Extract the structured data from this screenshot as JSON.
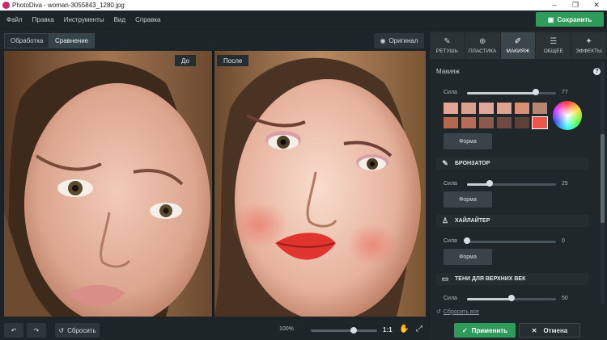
{
  "window": {
    "title": "PhotoDiva - woman-3055843_1280.jpg",
    "controls": [
      "–",
      "❐",
      "✕"
    ]
  },
  "menu": [
    "Файл",
    "Правка",
    "Инструменты",
    "Вид",
    "Справка"
  ],
  "save_label": "Сохранить",
  "modes": [
    "Обработка",
    "Сравнение"
  ],
  "original_label": "Оригинал",
  "tags": {
    "before": "До",
    "after": "После"
  },
  "bottom": {
    "reset_label": "Сбросить",
    "zoom": "100%",
    "zoom_level": 0.65,
    "ratio": "1:1"
  },
  "tabs": [
    {
      "label": "РЕТУШЬ",
      "icon": "retouch-icon",
      "glyph": "✎"
    },
    {
      "label": "ПЛАСТИКА",
      "icon": "plastic-icon",
      "glyph": "⊕"
    },
    {
      "label": "МАКИЯЖ",
      "icon": "makeup-icon",
      "glyph": "✐"
    },
    {
      "label": "ОБЩЕЕ",
      "icon": "sliders-icon",
      "glyph": "☰"
    },
    {
      "label": "ЭФФЕКТЫ",
      "icon": "effects-icon",
      "glyph": "✦"
    }
  ],
  "panel": {
    "heading": "Макияж",
    "help": "?",
    "blush": {
      "strength_label": "Сила",
      "strength_value": "77",
      "strength_level": 0.77,
      "swatches": [
        "#e3a693",
        "#dba18f",
        "#e1a89a",
        "#e0a590",
        "#d88f73",
        "#b88571",
        "#b2684e",
        "#b56d57",
        "#8c5a4d",
        "#6e4a42",
        "#5d4036",
        "#e8574a"
      ],
      "form_label": "Форма"
    },
    "bronzer": {
      "title": "БРОНЗАТОР",
      "strength_label": "Сила",
      "strength_value": "25",
      "strength_level": 0.25,
      "form_label": "Форма"
    },
    "highlighter": {
      "title": "ХАЙЛАЙТЕР",
      "strength_label": "Сила",
      "strength_value": "0",
      "strength_level": 0.0,
      "form_label": "Форма"
    },
    "eyeshadow": {
      "title": "ТЕНИ ДЛЯ ВЕРХНИХ ВЕК",
      "strength_label": "Сила",
      "strength_value": "50",
      "strength_level": 0.5
    },
    "reset_all": "Сбросить все"
  },
  "apply_label": "Применить",
  "cancel_label": "Отмена",
  "colors": {
    "accent_green": "#2e9b5a",
    "panel_bg": "#20272b"
  }
}
